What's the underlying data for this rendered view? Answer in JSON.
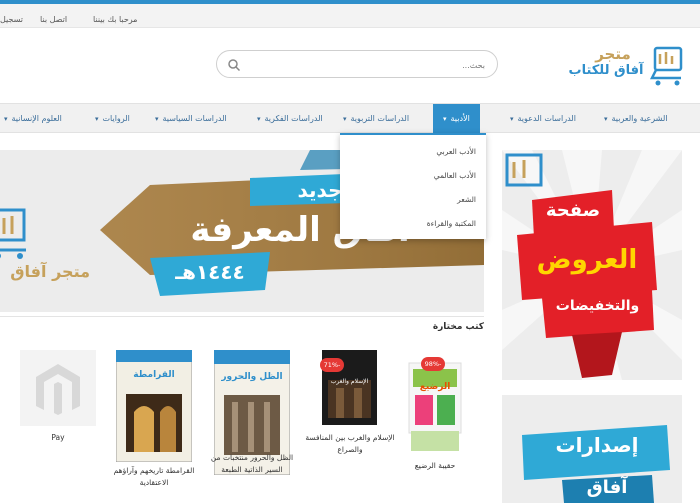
{
  "topbar": {
    "welcome": "مرحبا بك بيننا",
    "contact": "اتصل بنا",
    "register": "تسجيل"
  },
  "header": {
    "logo_line1": "متجر",
    "logo_line2": "آفاق للكتاب",
    "logo_mark": "آفاق",
    "search_placeholder": "بحث..."
  },
  "nav": {
    "items": [
      {
        "label": "الشرعية والعربية"
      },
      {
        "label": "الدراسات الدعوية"
      },
      {
        "label": "الأدبية"
      },
      {
        "label": "الدراسات التربوية"
      },
      {
        "label": "الدراسات الفكرية"
      },
      {
        "label": "الدراسات السياسية"
      },
      {
        "label": "الروايات"
      },
      {
        "label": "العلوم الإنسانية"
      }
    ],
    "dropdown": [
      {
        "label": "الأدب العربي"
      },
      {
        "label": "الأدب العالمي"
      },
      {
        "label": "الشعر"
      },
      {
        "label": "المكتبة والقراءة"
      }
    ]
  },
  "banner": {
    "tag": "جديد",
    "headline": "آفاق المعرفة",
    "year": "١٤٤٤هـ",
    "store": "متجر آفاق"
  },
  "side_promo": {
    "line1": "صفحة",
    "line2": "العروض",
    "line3": "والتخفيضات",
    "promo2_line1": "إصدارات",
    "promo2_line2": "آفاق"
  },
  "products": {
    "section_title": "كتب مختارة",
    "items": [
      {
        "title": "حقيبة الرضيع",
        "badge": "-98%",
        "cover_text": "الرضيع"
      },
      {
        "title": "الإسلام والغرب بين المنافسة والصراع",
        "badge": "-71%",
        "cover_text": "الإسلام والغرب"
      },
      {
        "title": "الظل والحرور منتخبات من السير الذاتية الطبعة",
        "badge": "",
        "cover_text": "الظل والحرور"
      },
      {
        "title": "القرامطة تاريخهم وآراؤهم الاعتقادية",
        "badge": "",
        "cover_text": "القرامطة"
      },
      {
        "title": "Pay",
        "badge": "",
        "cover_text": ""
      }
    ]
  },
  "colors": {
    "accent": "#2f8fcb",
    "gold": "#c6a15b",
    "sale": "#e53935",
    "promo_red": "#e32028"
  }
}
